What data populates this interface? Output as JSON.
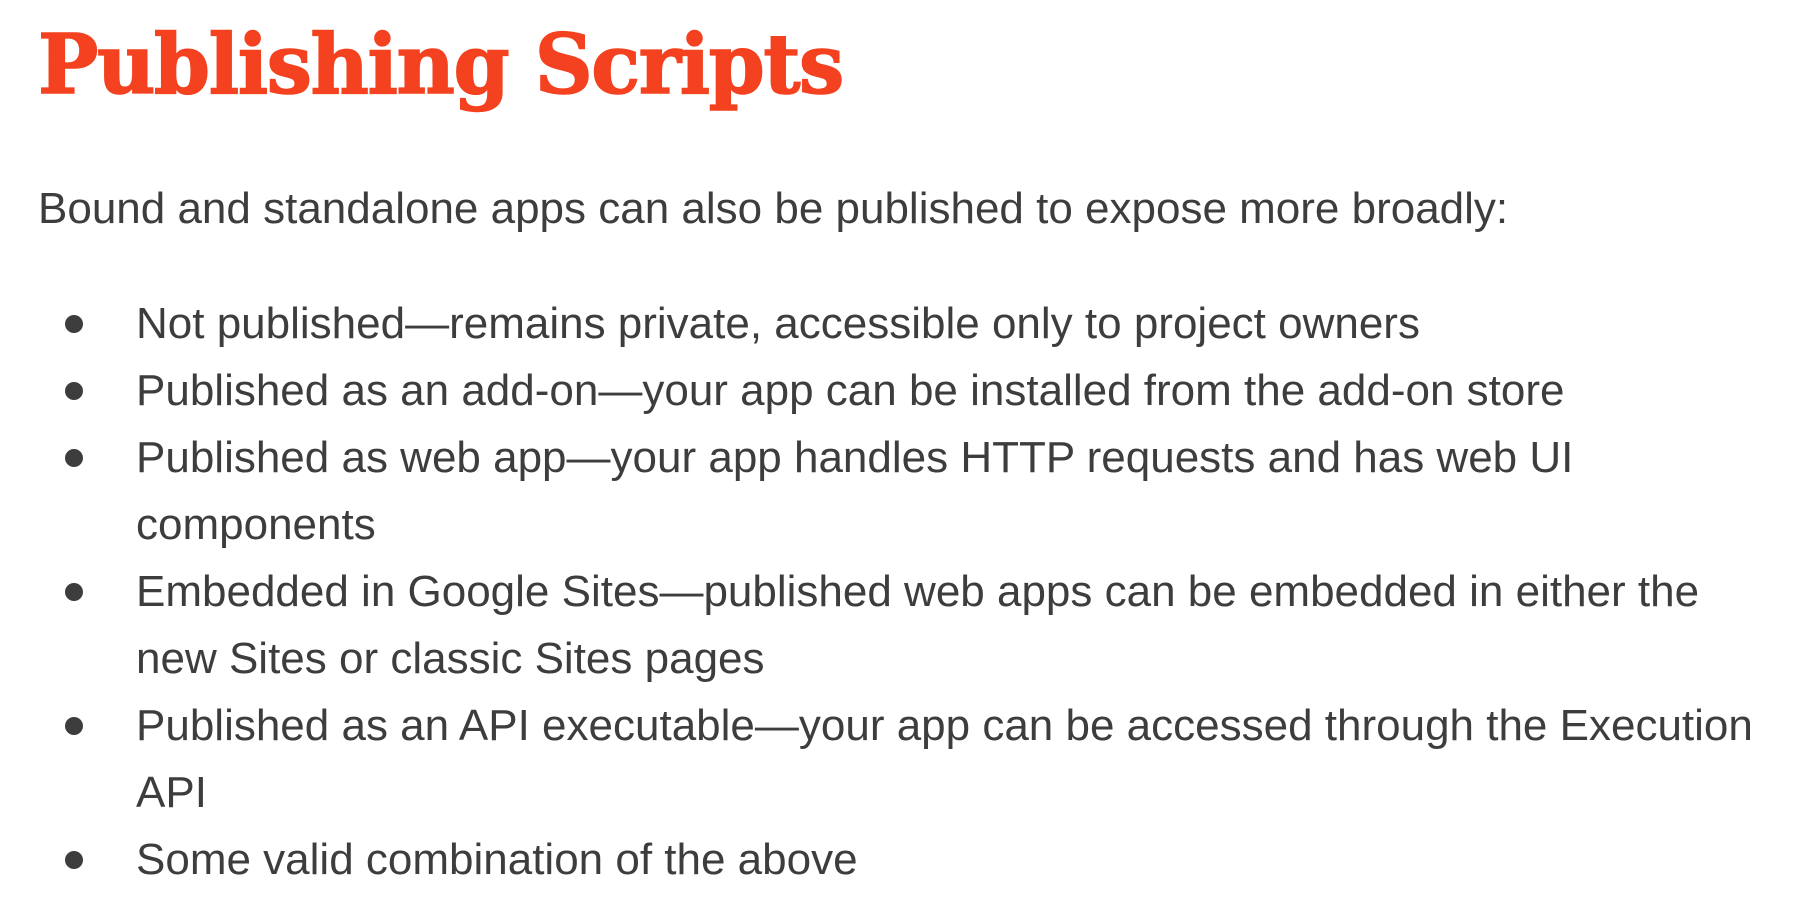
{
  "slide": {
    "title": "Publishing Scripts",
    "intro": "Bound and standalone apps can also be published to expose more broadly:",
    "bullets": [
      "Not published—remains private, accessible only to project owners",
      "Published as an add-on—your app can be installed from the add-on store",
      "Published as web app—your app handles HTTP requests and has web UI components",
      "Embedded in Google Sites—published web apps can be embedded in either the new Sites or classic Sites pages",
      "Published as an API executable—your app can be accessed through the Execution API",
      "Some valid combination of the above"
    ]
  },
  "colors": {
    "title": "#f4411f",
    "body_text": "#3d3d3d",
    "background": "#ffffff"
  }
}
